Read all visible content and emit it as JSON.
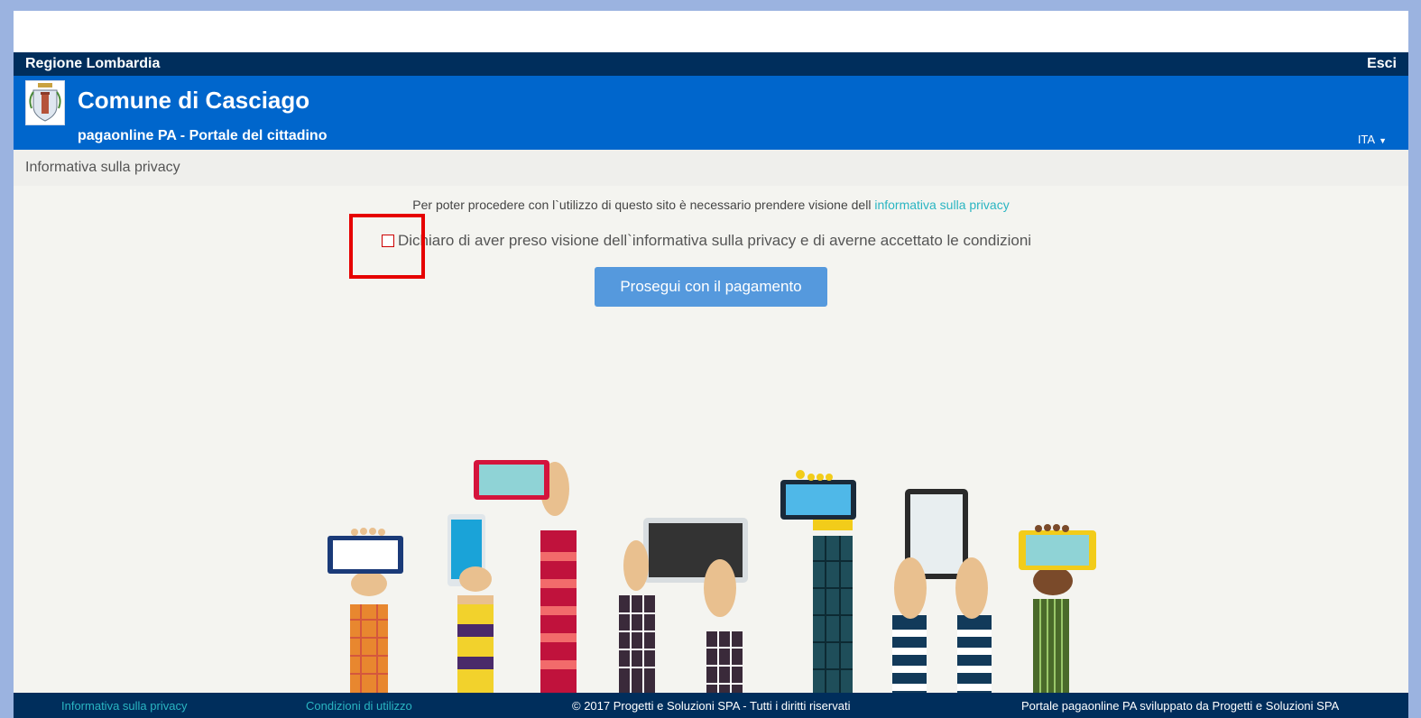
{
  "top_bar": {
    "region": "Regione Lombardia",
    "exit": "Esci"
  },
  "header": {
    "title": "Comune di Casciago",
    "subtitle": "pagaonline PA - Portale del cittadino",
    "language": "ITA"
  },
  "breadcrumb": "Informativa sulla privacy",
  "notice": {
    "text": "Per poter procedere con l`utilizzo di questo sito è necessario prendere visione dell",
    "link": "informativa sulla privacy"
  },
  "consent": {
    "label": "Dichiaro di aver preso visione dell`informativa sulla privacy e di averne accettato le condizioni",
    "checked": false
  },
  "button": {
    "label": "Prosegui con il pagamento"
  },
  "footer": {
    "privacy_link": "Informativa sulla privacy",
    "terms_link": "Condizioni di utilizzo",
    "copyright": "© 2017 Progetti e Soluzioni SPA - Tutti i diritti riservati",
    "credit": "Portale pagaonline PA sviluppato da Progetti e Soluzioni SPA"
  },
  "colors": {
    "top_bar": "#002e5c",
    "header": "#0066cc",
    "button": "#5599dd",
    "link": "#2ab5c2",
    "highlight": "#e60000"
  }
}
